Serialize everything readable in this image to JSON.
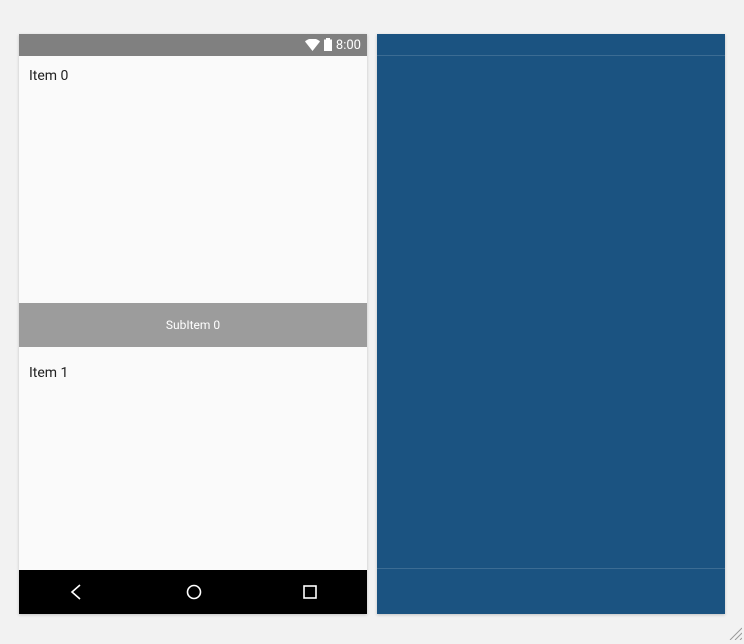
{
  "status_bar": {
    "time": "8:00"
  },
  "list": {
    "items": [
      {
        "label": "Item 0"
      },
      {
        "label": "Item 1"
      }
    ],
    "sub_items": [
      {
        "label": "SubItem 0"
      }
    ]
  },
  "colors": {
    "right_panel_bg": "#1b5381",
    "status_bar_bg": "#808080",
    "sub_item_bg": "#9c9c9c"
  }
}
